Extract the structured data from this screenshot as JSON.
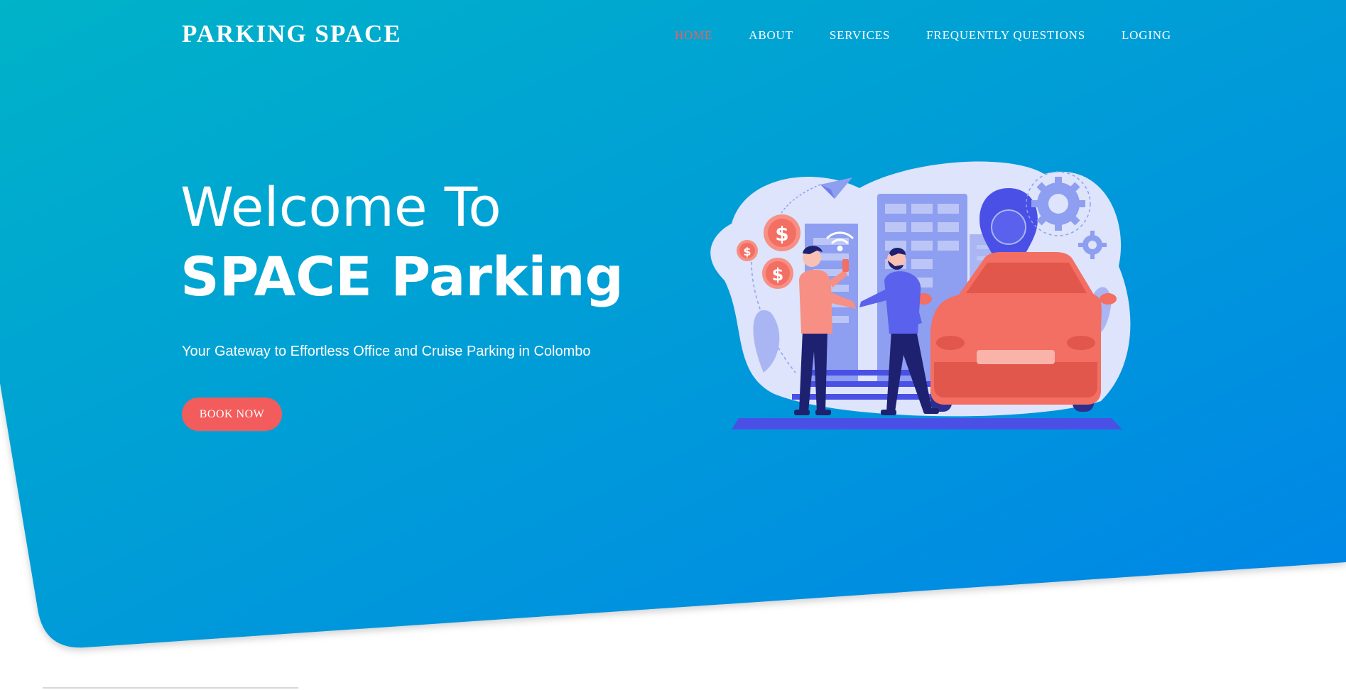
{
  "brand": {
    "name": "PARKING SPACE"
  },
  "nav": {
    "items": [
      {
        "label": "HOME",
        "active": true
      },
      {
        "label": "ABOUT",
        "active": false
      },
      {
        "label": "SERVICES",
        "active": false
      },
      {
        "label": "FREQUENTLY QUESTIONS",
        "active": false
      },
      {
        "label": "LOGING",
        "active": false
      }
    ]
  },
  "hero": {
    "title_line1": "Welcome To",
    "title_line2": "SPACE Parking",
    "subtitle": "Your Gateway to Effortless Office and Cruise Parking in Colombo",
    "cta_label": "BOOK NOW"
  },
  "illustration": {
    "icons": [
      "dollar-coin-icon",
      "paper-plane-icon",
      "wifi-icon",
      "map-pin-icon",
      "gear-icon",
      "car-icon",
      "building-icon"
    ]
  },
  "colors": {
    "gradient_start": "#00b3c8",
    "gradient_end": "#0084e8",
    "accent": "#f25c5c",
    "illustration_purple": "#4a50e6",
    "illustration_lavender": "#dde4fb"
  }
}
